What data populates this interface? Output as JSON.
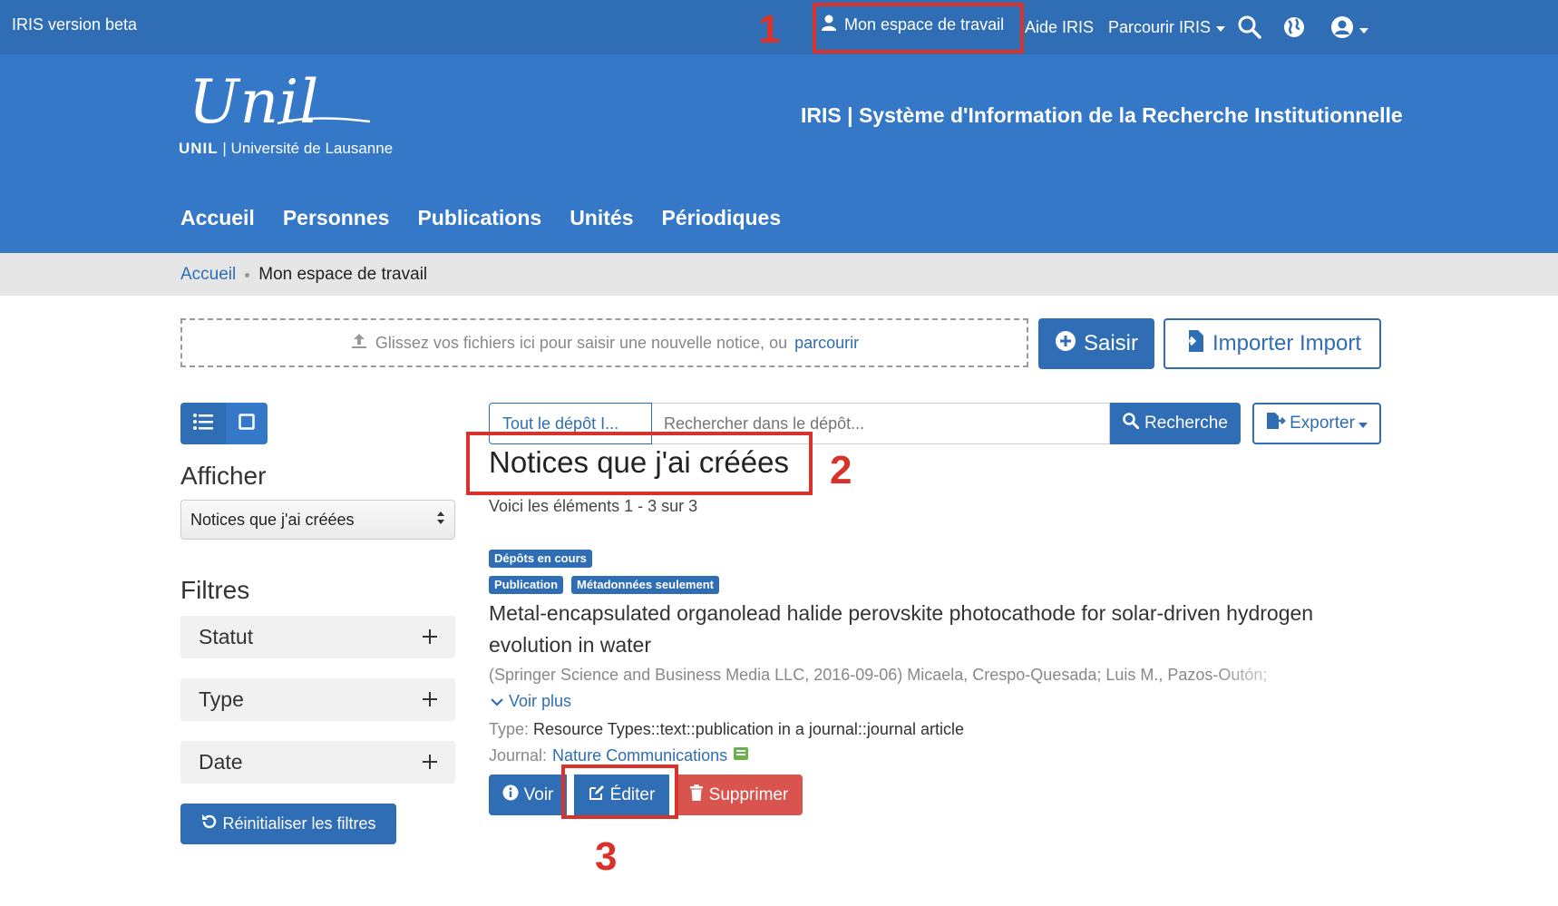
{
  "topbar": {
    "version_label": "IRIS version beta",
    "workspace": "Mon espace de travail",
    "help": "Aide IRIS",
    "browse": "Parcourir IRIS"
  },
  "header": {
    "logo_script": "Unil",
    "logo_unil": "UNIL",
    "logo_university": "| Université de Lausanne",
    "site_title": "IRIS | Système d'Information de la Recherche Institutionnelle"
  },
  "nav": {
    "items": [
      "Accueil",
      "Personnes",
      "Publications",
      "Unités",
      "Périodiques"
    ]
  },
  "breadcrumb": {
    "home": "Accueil",
    "current": "Mon espace de travail"
  },
  "upload": {
    "text": "Glissez vos fichiers ici pour saisir une nouvelle notice, ou",
    "link": "parcourir",
    "submit_label": "Saisir",
    "import_label": "Importer Import"
  },
  "search": {
    "scope": "Tout le dépôt I...",
    "placeholder": "Rechercher dans le dépôt...",
    "button": "Recherche",
    "export": "Exporter"
  },
  "sidebar": {
    "display_heading": "Afficher",
    "display_select": "Notices que j'ai créées",
    "filters_heading": "Filtres",
    "filters": [
      "Statut",
      "Type",
      "Date"
    ],
    "reset": "Réinitialiser les filtres"
  },
  "results": {
    "heading": "Notices que j'ai créées",
    "count": "Voici les éléments 1 - 3 sur 3",
    "item": {
      "badge_status": "Dépôts en cours",
      "badge_type": "Publication",
      "badge_meta": "Métadonnées seulement",
      "title_line1": "Metal-encapsulated organolead halide perovskite photocathode for solar-driven hydrogen",
      "title_line2": "evolution in water",
      "citation": "(Springer Science and Business Media LLC, 2016-09-06) Micaela, Crespo-Quesada; Luis M., Pazos-Outón;",
      "more": "Voir plus",
      "type_label": "Type:",
      "type_value": "Resource Types::text::publication in a journal::journal article",
      "journal_label": "Journal:",
      "journal_value": "Nature Communications",
      "view": "Voir",
      "edit": "Éditer",
      "delete": "Supprimer"
    }
  },
  "annotations": [
    "1",
    "2",
    "3"
  ],
  "colors": {
    "primary": "#3478c7",
    "topbar": "#2f6db5",
    "danger": "#d9534f",
    "annotation": "#d9322a"
  }
}
